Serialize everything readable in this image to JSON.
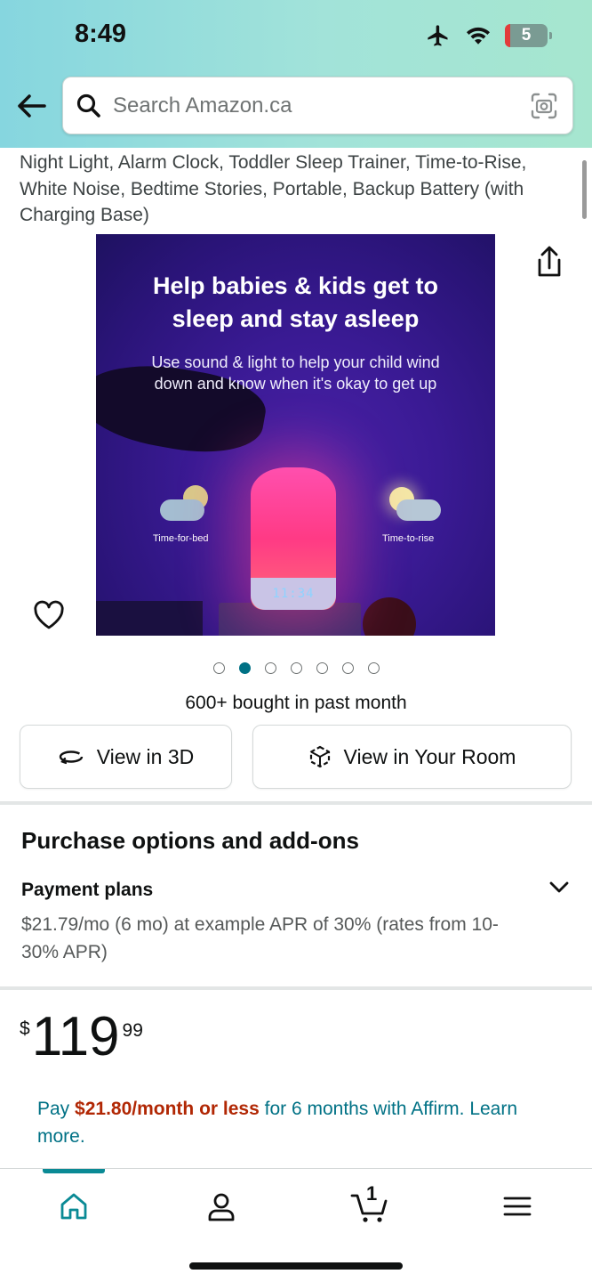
{
  "status_bar": {
    "time": "8:49",
    "battery_level": "5"
  },
  "search": {
    "placeholder": "Search Amazon.ca"
  },
  "product": {
    "title": "Night Light, Alarm Clock, Toddler Sleep Trainer, Time-to-Rise, White Noise, Bedtime Stories, Portable, Backup Battery (with Charging Base)",
    "image": {
      "headline": "Help babies & kids get to sleep and stay asleep",
      "subtext": "Use sound & light to help your child wind down and know when it's okay to get up",
      "label_left": "Time-for-bed",
      "label_right": "Time-to-rise",
      "clock": "11:34"
    },
    "carousel": {
      "count": 7,
      "active_index": 1
    },
    "bought": "600+ bought in past month",
    "view_3d_label": "View in 3D",
    "view_room_label": "View in Your Room"
  },
  "purchase_options": {
    "title": "Purchase options and add-ons",
    "payment_plans_title": "Payment plans",
    "payment_plans_desc": "$21.79/mo (6 mo) at example APR of 30% (rates from 10-30% APR)"
  },
  "price": {
    "symbol": "$",
    "whole": "119",
    "fraction": "99"
  },
  "affirm": {
    "prefix": "Pay ",
    "amount": "$21.80/month or less",
    "suffix": " for 6 months with Affirm. Learn more."
  },
  "bottom_nav": {
    "cart_count": "1"
  },
  "colors": {
    "accent": "#007185",
    "price_red": "#b12704",
    "nav_teal": "#0a8a95"
  }
}
